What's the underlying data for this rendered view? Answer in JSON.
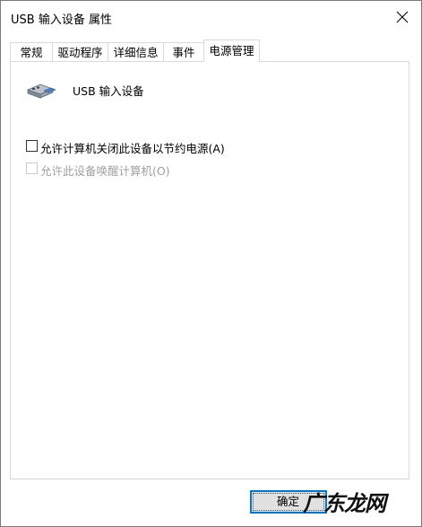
{
  "window": {
    "title": "USB 输入设备 属性"
  },
  "tabs": [
    {
      "label": "常规"
    },
    {
      "label": "驱动程序"
    },
    {
      "label": "详细信息"
    },
    {
      "label": "事件"
    },
    {
      "label": "电源管理"
    }
  ],
  "active_tab": "电源管理",
  "device": {
    "name": "USB 输入设备",
    "icon": "usb-connector-icon"
  },
  "options": {
    "allow_power_off": {
      "label": "允许计算机关闭此设备以节约电源(A)",
      "checked": false,
      "enabled": true
    },
    "allow_wake": {
      "label": "允许此设备唤醒计算机(O)",
      "checked": false,
      "enabled": false
    }
  },
  "buttons": {
    "ok_label": "确定"
  },
  "watermark": {
    "text": "广东龙网"
  },
  "colors": {
    "focus_border": "#0078d7",
    "button_face": "#e1e1e1",
    "disabled_text": "#a0a0a0"
  }
}
